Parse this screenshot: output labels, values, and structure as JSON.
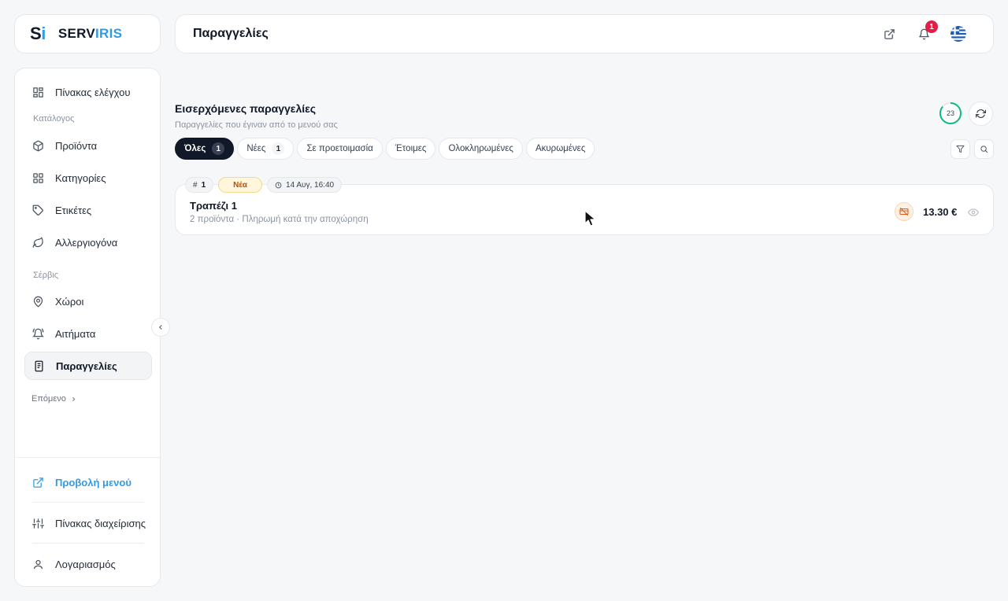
{
  "brand": {
    "mark_s": "S",
    "mark_i": "i",
    "name_part1": "SERV",
    "name_part2": "IRIS"
  },
  "header": {
    "title": "Παραγγελίες",
    "notifications_count": "1"
  },
  "sidebar": {
    "dashboard": "Πίνακας ελέγχου",
    "catalog_label": "Κατάλογος",
    "products": "Προϊόντα",
    "categories": "Κατηγορίες",
    "tags": "Ετικέτες",
    "allergens": "Αλλεργιογόνα",
    "service_label": "Σέρβις",
    "spaces": "Χώροι",
    "requests": "Αιτήματα",
    "orders": "Παραγγελίες",
    "next": "Επόμενο",
    "view_menu": "Προβολή μενού",
    "admin_panel": "Πίνακας διαχείρισης",
    "account": "Λογαριασμός"
  },
  "main": {
    "heading": "Εισερχόμενες παραγγελίες",
    "subheading": "Παραγγελίες που έγιναν από το μενού σας",
    "timer_value": "23",
    "tabs": [
      {
        "label": "Όλες",
        "count": "1"
      },
      {
        "label": "Νέες",
        "count": "1"
      },
      {
        "label": "Σε προετοιμασία",
        "count": ""
      },
      {
        "label": "Έτοιμες",
        "count": ""
      },
      {
        "label": "Ολοκληρωμένες",
        "count": ""
      },
      {
        "label": "Ακυρωμένες",
        "count": ""
      }
    ],
    "order": {
      "hash": "#",
      "number": "1",
      "status": "Νέα",
      "time": "14 Αυγ, 16:40",
      "title": "Τραπέζι 1",
      "subtitle": "2 προϊόντα · Πληρωμή κατά την αποχώρηση",
      "price": "13.30 €"
    }
  },
  "colors": {
    "accent": "#2f9be6",
    "dark": "#111827",
    "badge": "#e11d48",
    "timer_ring": "#10b981",
    "new_status": "#b45309"
  },
  "icons": [
    "external-link-icon",
    "bell-icon",
    "greek-flag-icon",
    "refresh-icon",
    "filter-icon",
    "search-icon",
    "clock-icon",
    "unpaid-icon",
    "eye-icon",
    "chevron-left-icon",
    "chevron-right-icon"
  ]
}
